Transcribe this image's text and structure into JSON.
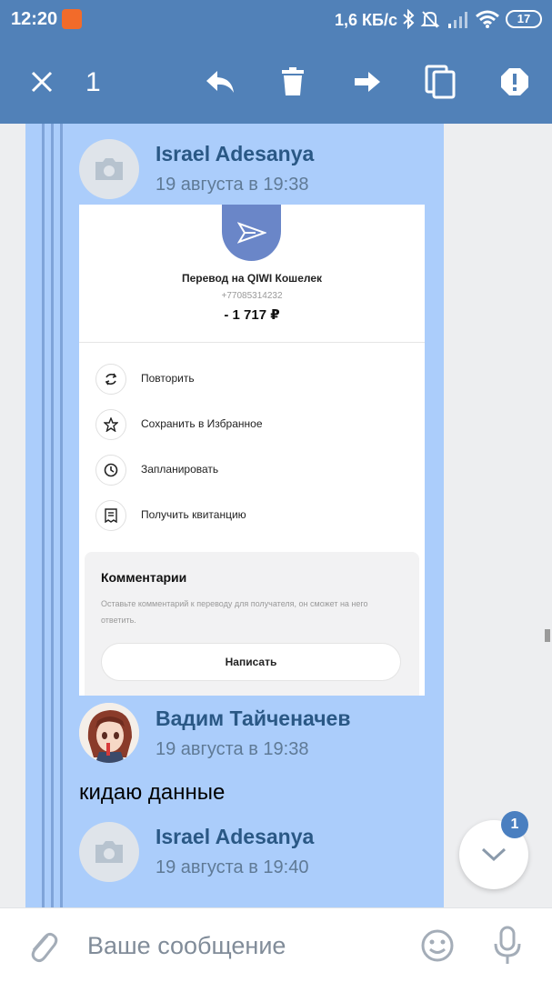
{
  "status_bar": {
    "time": "12:20",
    "network_speed": "1,6 КБ/с",
    "battery": "17",
    "icons": [
      "notification-icon",
      "bluetooth-icon",
      "mute-icon",
      "signal-icon",
      "wifi-icon",
      "battery-icon"
    ]
  },
  "action_bar": {
    "selected_count": "1",
    "icons": [
      "close-icon",
      "reply-icon",
      "delete-icon",
      "forward-icon",
      "copy-icon",
      "report-icon"
    ]
  },
  "messages": [
    {
      "author": "Israel Adesanya",
      "date": "19 августа в 19:38",
      "attachment": {
        "title": "Перевод на QIWI Кошелек",
        "phone": "+77085314232",
        "amount": "- 1 717 ₽",
        "actions": [
          "Повторить",
          "Сохранить в Избранное",
          "Запланировать",
          "Получить квитанцию"
        ],
        "comments_title": "Комментарии",
        "comments_desc": "Оставьте комментарий к переводу для получателя, он сможет на него ответить.",
        "comments_button": "Написать"
      }
    },
    {
      "author": "Вадим Тайченачев",
      "date": "19 августа в 19:38",
      "text": "кидаю данные"
    },
    {
      "author": "Israel Adesanya",
      "date": "19 августа в 19:40"
    }
  ],
  "scroll_fab": {
    "badge": "1"
  },
  "composer": {
    "placeholder": "Ваше сообщение"
  },
  "colors": {
    "header": "#5181b8",
    "selection": "#abcdfb",
    "author": "#2a5885"
  }
}
